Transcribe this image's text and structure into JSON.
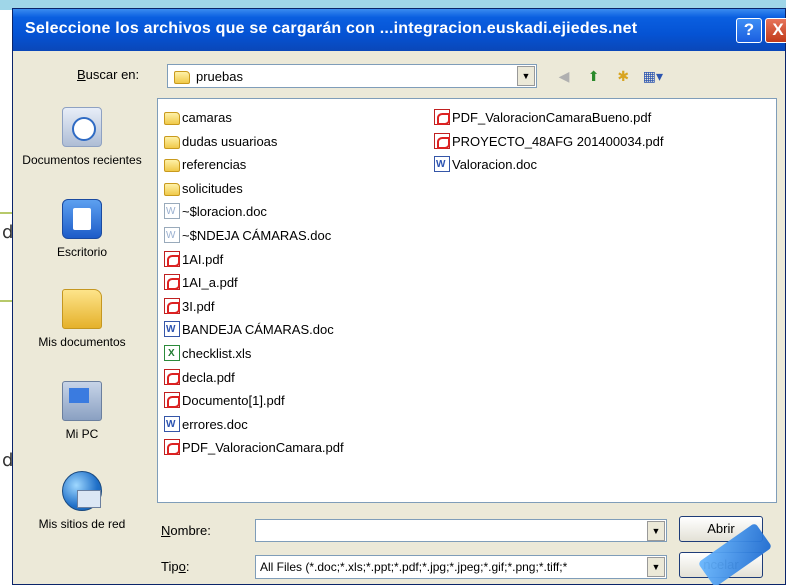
{
  "dialog": {
    "title": "Seleccione los archivos que se cargarán con ...integracion.euskadi.ejiedes.net",
    "help_label": "?",
    "close_label": "X"
  },
  "lookin": {
    "label": "Buscar en:",
    "value": "pruebas"
  },
  "places": [
    {
      "label": "Documentos recientes",
      "icon": "recent-documents-icon"
    },
    {
      "label": "Escritorio",
      "icon": "desktop-icon"
    },
    {
      "label": "Mis documentos",
      "icon": "my-documents-icon"
    },
    {
      "label": "Mi PC",
      "icon": "my-computer-icon"
    },
    {
      "label": "Mis sitios de red",
      "icon": "network-places-icon"
    }
  ],
  "files_col1": [
    {
      "name": "camaras",
      "type": "folder"
    },
    {
      "name": "dudas usuarioas",
      "type": "folder"
    },
    {
      "name": "referencias",
      "type": "folder"
    },
    {
      "name": "solicitudes",
      "type": "folder"
    },
    {
      "name": "~$loracion.doc",
      "type": "doc-temp"
    },
    {
      "name": "~$NDEJA CÁMARAS.doc",
      "type": "doc-temp"
    },
    {
      "name": "1AI.pdf",
      "type": "pdf"
    },
    {
      "name": "1AI_a.pdf",
      "type": "pdf"
    },
    {
      "name": "3I.pdf",
      "type": "pdf"
    },
    {
      "name": "BANDEJA CÁMARAS.doc",
      "type": "doc"
    },
    {
      "name": "checklist.xls",
      "type": "xls"
    },
    {
      "name": "decla.pdf",
      "type": "pdf"
    },
    {
      "name": "Documento[1].pdf",
      "type": "pdf"
    },
    {
      "name": "errores.doc",
      "type": "doc"
    },
    {
      "name": "PDF_ValoracionCamara.pdf",
      "type": "pdf"
    }
  ],
  "files_col2": [
    {
      "name": "PDF_ValoracionCamaraBueno.pdf",
      "type": "pdf"
    },
    {
      "name": "PROYECTO_48AFG 201400034.pdf",
      "type": "pdf"
    },
    {
      "name": "Valoracion.doc",
      "type": "doc"
    }
  ],
  "name_field": {
    "label": "Nombre:",
    "value": ""
  },
  "type_field": {
    "label": "Tipo:",
    "value": "All Files (*.doc;*.xls;*.ppt;*.pdf;*.jpg;*.jpeg;*.gif;*.png;*.tiff;*"
  },
  "buttons": {
    "open": "Abrir",
    "cancel": "ncelar"
  },
  "colors": {
    "titlebar": "#0553d4",
    "accent": "#0a246a",
    "dialog_bg": "#ece9d8"
  }
}
